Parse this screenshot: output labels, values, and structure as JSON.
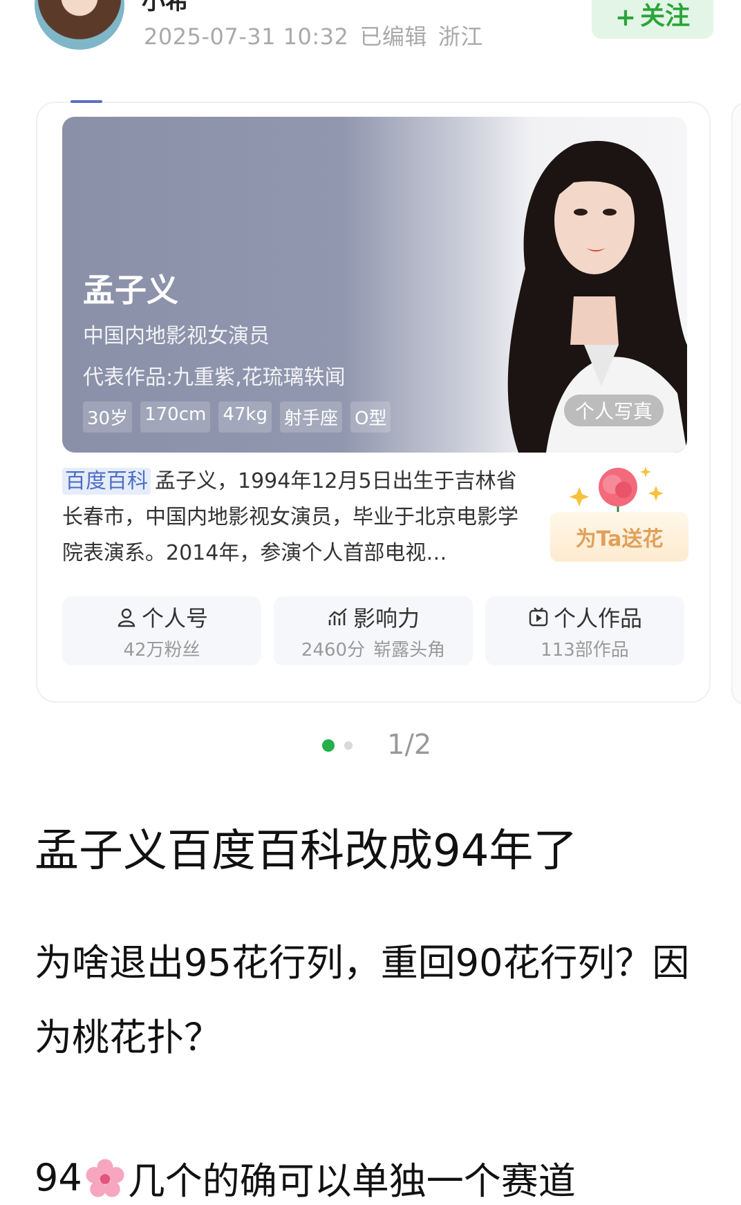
{
  "header": {
    "author_name": "小希",
    "timestamp": "2025-07-31 10:32",
    "edited": "已编辑",
    "location": "浙江",
    "follow_label": "关注",
    "follow_plus": "+"
  },
  "card": {
    "name": "孟子义",
    "role": "中国内地影视女演员",
    "works": "代表作品:九重紫,花琉璃轶闻",
    "tags": [
      "30岁",
      "170cm",
      "47kg",
      "射手座",
      "O型"
    ],
    "photo_button": "个人写真",
    "baike_badge": "百度百科",
    "summary": "孟子义，1994年12月5日出生于吉林省长春市，中国内地影视女演员，毕业于北京电影学院表演系。2014年，参演个人首部电视…",
    "flower_button": "为Ta送花",
    "stats": [
      {
        "icon": "person-icon",
        "title": "个人号",
        "sub": [
          "42万粉丝"
        ]
      },
      {
        "icon": "chart-icon",
        "title": "影响力",
        "sub": [
          "2460分",
          "崭露头角"
        ]
      },
      {
        "icon": "play-icon",
        "title": "个人作品",
        "sub": [
          "113部作品"
        ]
      }
    ]
  },
  "pagination": {
    "indicator": "1/2"
  },
  "post": {
    "title": "孟子义百度百科改成94年了",
    "paragraph": "为啥退出95花行列，重回90花行列？因为桃花扑？",
    "line3_prefix": "94",
    "line3_suffix": "几个的确可以单独一个赛道"
  },
  "colors": {
    "accent_green": "#22b04a",
    "follow_bg": "#e3f5e6",
    "baike_blue": "#4e6ec6"
  }
}
